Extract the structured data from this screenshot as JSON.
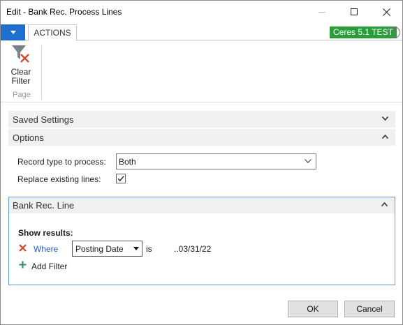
{
  "window": {
    "title": "Edit - Bank Rec. Process Lines"
  },
  "ribbon": {
    "tab_actions": "ACTIONS",
    "environment_badge": "Ceres 5.1 TEST",
    "help_glyph": "?",
    "clear_filter_line1": "Clear",
    "clear_filter_line2": "Filter",
    "group_label": "Page"
  },
  "sections": {
    "saved_settings": "Saved Settings",
    "options": "Options",
    "bank_rec_line": "Bank Rec. Line"
  },
  "options": {
    "record_type_label": "Record type to process:",
    "record_type_value": "Both",
    "replace_label": "Replace existing lines:",
    "replace_checked": true
  },
  "filter": {
    "show_results": "Show results:",
    "where": "Where",
    "field": "Posting Date",
    "operator": "is",
    "value": "..03/31/22",
    "add_filter": "Add Filter"
  },
  "buttons": {
    "ok": "OK",
    "cancel": "Cancel"
  },
  "colors": {
    "accent": "#1f6fd0",
    "badge": "#2a9d3a",
    "link": "#1f5fbf",
    "remove": "#d9472b",
    "add": "#3b8f6b"
  },
  "icons": {
    "minimize": "minimize-icon",
    "maximize": "maximize-icon",
    "close": "close-icon",
    "clear_filter": "clear-filter-icon",
    "expand": "chevron-down-icon",
    "collapse": "chevron-up-icon",
    "remove": "remove-filter-icon",
    "add": "plus-icon",
    "checkmark": "checkmark-icon"
  }
}
